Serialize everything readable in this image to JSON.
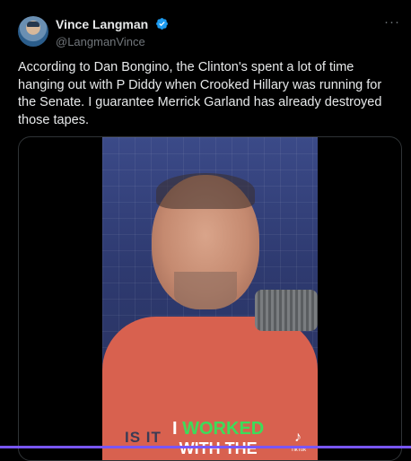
{
  "author": {
    "display_name": "Vince Langman",
    "handle": "@LangmanVince"
  },
  "more_label": "···",
  "tweet": {
    "text": "According to Dan Bongino, the Clinton's spent a lot of time hanging out with P Diddy when Crooked Hillary was running for the Senate. I guarantee Merrick Garland has already destroyed those tapes."
  },
  "video": {
    "caption_line1_prefix": "I ",
    "caption_line1_highlight": "WORKED",
    "caption_line2": "WITH THE",
    "shirt_text": "IS IT",
    "watermark": "TikTok"
  },
  "colors": {
    "background": "#000000",
    "verified": "#1d9bf0",
    "caption_highlight": "#3ddc5a",
    "accent_bar": "#7856ff"
  }
}
